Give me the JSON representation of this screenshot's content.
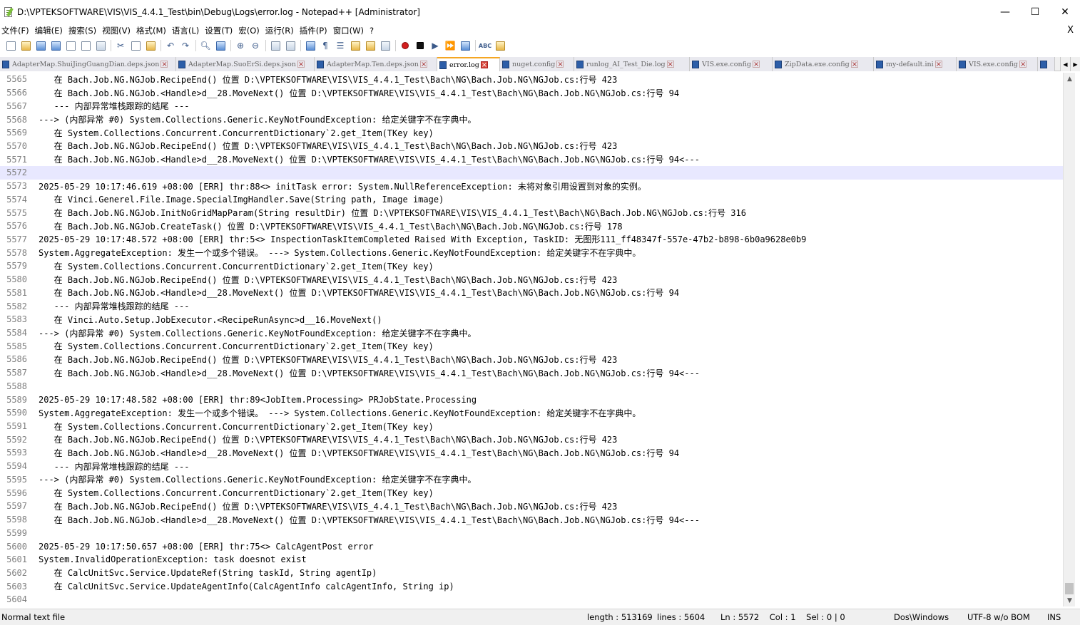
{
  "window": {
    "title": "D:\\VPTEKSOFTWARE\\VIS\\VIS_4.4.1_Test\\bin\\Debug\\Logs\\error.log - Notepad++ [Administrator]",
    "minimize": "—",
    "maximize": "☐",
    "close": "✕"
  },
  "menu": {
    "items": [
      "文件(F)",
      "编辑(E)",
      "搜索(S)",
      "视图(V)",
      "格式(M)",
      "语言(L)",
      "设置(T)",
      "宏(O)",
      "运行(R)",
      "插件(P)",
      "窗口(W)",
      "?"
    ],
    "close": "X"
  },
  "toolbar": {
    "icons": [
      "new-file-icon",
      "open-file-icon",
      "save-icon",
      "save-all-icon",
      "close-icon",
      "close-all-icon",
      "print-icon",
      "cut-icon",
      "copy-icon",
      "paste-icon",
      "undo-icon",
      "redo-icon",
      "find-icon",
      "replace-icon",
      "zoom-in-icon",
      "zoom-out-icon",
      "sync-vertical-icon",
      "sync-horizontal-icon",
      "word-wrap-icon",
      "show-all-chars-icon",
      "indent-guide-icon",
      "folder-as-workspace-icon",
      "function-list-icon",
      "document-map-icon",
      "record-macro-icon",
      "stop-record-icon",
      "play-macro-icon",
      "play-multiple-icon",
      "save-macro-icon",
      "spell-check-icon",
      "spell-options-icon"
    ]
  },
  "tabs": [
    {
      "label": "AdapterMap.ShuiJingGuangDian.deps.json",
      "active": false
    },
    {
      "label": "AdapterMap.SuoErSi.deps.json",
      "active": false
    },
    {
      "label": "AdapterMap.Ten.deps.json",
      "active": false
    },
    {
      "label": "error.log",
      "active": true
    },
    {
      "label": "nuget.config",
      "active": false
    },
    {
      "label": "runlog_AI_Test_Die.log",
      "active": false
    },
    {
      "label": "VIS.exe.config",
      "active": false
    },
    {
      "label": "ZipData.exe.config",
      "active": false
    },
    {
      "label": "my-default.ini",
      "active": false
    },
    {
      "label": "VIS.exe.config",
      "active": false
    }
  ],
  "editor": {
    "current_line": 5572,
    "lines": [
      {
        "n": "5565",
        "t": "   在 Bach.Job.NG.NGJob.RecipeEnd() 位置 D:\\VPTEKSOFTWARE\\VIS\\VIS_4.4.1_Test\\Bach\\NG\\Bach.Job.NG\\NGJob.cs:行号 423"
      },
      {
        "n": "5566",
        "t": "   在 Bach.Job.NG.NGJob.<Handle>d__28.MoveNext() 位置 D:\\VPTEKSOFTWARE\\VIS\\VIS_4.4.1_Test\\Bach\\NG\\Bach.Job.NG\\NGJob.cs:行号 94"
      },
      {
        "n": "5567",
        "t": "   --- 内部异常堆栈跟踪的结尾 ---"
      },
      {
        "n": "5568",
        "t": "---> (内部异常 #0) System.Collections.Generic.KeyNotFoundException: 给定关键字不在字典中。"
      },
      {
        "n": "5569",
        "t": "   在 System.Collections.Concurrent.ConcurrentDictionary`2.get_Item(TKey key)"
      },
      {
        "n": "5570",
        "t": "   在 Bach.Job.NG.NGJob.RecipeEnd() 位置 D:\\VPTEKSOFTWARE\\VIS\\VIS_4.4.1_Test\\Bach\\NG\\Bach.Job.NG\\NGJob.cs:行号 423"
      },
      {
        "n": "5571",
        "t": "   在 Bach.Job.NG.NGJob.<Handle>d__28.MoveNext() 位置 D:\\VPTEKSOFTWARE\\VIS\\VIS_4.4.1_Test\\Bach\\NG\\Bach.Job.NG\\NGJob.cs:行号 94<---"
      },
      {
        "n": "5572",
        "t": ""
      },
      {
        "n": "5573",
        "t": "2025-05-29 10:17:46.619 +08:00 [ERR] thr:88<> initTask error: System.NullReferenceException: 未将对象引用设置到对象的实例。"
      },
      {
        "n": "5574",
        "t": "   在 Vinci.Generel.File.Image.SpecialImgHandler.Save(String path, Image image)"
      },
      {
        "n": "5575",
        "t": "   在 Bach.Job.NG.NGJob.InitNoGridMapParam(String resultDir) 位置 D:\\VPTEKSOFTWARE\\VIS\\VIS_4.4.1_Test\\Bach\\NG\\Bach.Job.NG\\NGJob.cs:行号 316"
      },
      {
        "n": "5576",
        "t": "   在 Bach.Job.NG.NGJob.CreateTask() 位置 D:\\VPTEKSOFTWARE\\VIS\\VIS_4.4.1_Test\\Bach\\NG\\Bach.Job.NG\\NGJob.cs:行号 178"
      },
      {
        "n": "5577",
        "t": "2025-05-29 10:17:48.572 +08:00 [ERR] thr:5<> InspectionTaskItemCompleted Raised With Exception, TaskID: 无图形111_ff48347f-557e-47b2-b898-6b0a9628e0b9"
      },
      {
        "n": "5578",
        "t": "System.AggregateException: 发生一个或多个错误。 ---> System.Collections.Generic.KeyNotFoundException: 给定关键字不在字典中。"
      },
      {
        "n": "5579",
        "t": "   在 System.Collections.Concurrent.ConcurrentDictionary`2.get_Item(TKey key)"
      },
      {
        "n": "5580",
        "t": "   在 Bach.Job.NG.NGJob.RecipeEnd() 位置 D:\\VPTEKSOFTWARE\\VIS\\VIS_4.4.1_Test\\Bach\\NG\\Bach.Job.NG\\NGJob.cs:行号 423"
      },
      {
        "n": "5581",
        "t": "   在 Bach.Job.NG.NGJob.<Handle>d__28.MoveNext() 位置 D:\\VPTEKSOFTWARE\\VIS\\VIS_4.4.1_Test\\Bach\\NG\\Bach.Job.NG\\NGJob.cs:行号 94"
      },
      {
        "n": "5582",
        "t": "   --- 内部异常堆栈跟踪的结尾 ---"
      },
      {
        "n": "5583",
        "t": "   在 Vinci.Auto.Setup.JobExecutor.<RecipeRunAsync>d__16.MoveNext()"
      },
      {
        "n": "5584",
        "t": "---> (内部异常 #0) System.Collections.Generic.KeyNotFoundException: 给定关键字不在字典中。"
      },
      {
        "n": "5585",
        "t": "   在 System.Collections.Concurrent.ConcurrentDictionary`2.get_Item(TKey key)"
      },
      {
        "n": "5586",
        "t": "   在 Bach.Job.NG.NGJob.RecipeEnd() 位置 D:\\VPTEKSOFTWARE\\VIS\\VIS_4.4.1_Test\\Bach\\NG\\Bach.Job.NG\\NGJob.cs:行号 423"
      },
      {
        "n": "5587",
        "t": "   在 Bach.Job.NG.NGJob.<Handle>d__28.MoveNext() 位置 D:\\VPTEKSOFTWARE\\VIS\\VIS_4.4.1_Test\\Bach\\NG\\Bach.Job.NG\\NGJob.cs:行号 94<---"
      },
      {
        "n": "5588",
        "t": ""
      },
      {
        "n": "5589",
        "t": "2025-05-29 10:17:48.582 +08:00 [ERR] thr:89<JobItem.Processing> PRJobState.Processing"
      },
      {
        "n": "5590",
        "t": "System.AggregateException: 发生一个或多个错误。 ---> System.Collections.Generic.KeyNotFoundException: 给定关键字不在字典中。"
      },
      {
        "n": "5591",
        "t": "   在 System.Collections.Concurrent.ConcurrentDictionary`2.get_Item(TKey key)"
      },
      {
        "n": "5592",
        "t": "   在 Bach.Job.NG.NGJob.RecipeEnd() 位置 D:\\VPTEKSOFTWARE\\VIS\\VIS_4.4.1_Test\\Bach\\NG\\Bach.Job.NG\\NGJob.cs:行号 423"
      },
      {
        "n": "5593",
        "t": "   在 Bach.Job.NG.NGJob.<Handle>d__28.MoveNext() 位置 D:\\VPTEKSOFTWARE\\VIS\\VIS_4.4.1_Test\\Bach\\NG\\Bach.Job.NG\\NGJob.cs:行号 94"
      },
      {
        "n": "5594",
        "t": "   --- 内部异常堆栈跟踪的结尾 ---"
      },
      {
        "n": "5595",
        "t": "---> (内部异常 #0) System.Collections.Generic.KeyNotFoundException: 给定关键字不在字典中。"
      },
      {
        "n": "5596",
        "t": "   在 System.Collections.Concurrent.ConcurrentDictionary`2.get_Item(TKey key)"
      },
      {
        "n": "5597",
        "t": "   在 Bach.Job.NG.NGJob.RecipeEnd() 位置 D:\\VPTEKSOFTWARE\\VIS\\VIS_4.4.1_Test\\Bach\\NG\\Bach.Job.NG\\NGJob.cs:行号 423"
      },
      {
        "n": "5598",
        "t": "   在 Bach.Job.NG.NGJob.<Handle>d__28.MoveNext() 位置 D:\\VPTEKSOFTWARE\\VIS\\VIS_4.4.1_Test\\Bach\\NG\\Bach.Job.NG\\NGJob.cs:行号 94<---"
      },
      {
        "n": "5599",
        "t": ""
      },
      {
        "n": "5600",
        "t": "2025-05-29 10:17:50.657 +08:00 [ERR] thr:75<> CalcAgentPost error"
      },
      {
        "n": "5601",
        "t": "System.InvalidOperationException: task doesnot exist"
      },
      {
        "n": "5602",
        "t": "   在 CalcUnitSvc.Service.UpdateRef(String taskId, String agentIp)"
      },
      {
        "n": "5603",
        "t": "   在 CalcUnitSvc.Service.UpdateAgentInfo(CalcAgentInfo calcAgentInfo, String ip)"
      },
      {
        "n": "5604",
        "t": ""
      }
    ]
  },
  "status": {
    "file_type": "Normal text file",
    "length": "length : 513169",
    "lines": "lines : 5604",
    "position": "Ln : 5572    Col : 1    Sel : 0 | 0",
    "eol": "Dos\\Windows",
    "encoding": "UTF-8 w/o BOM",
    "mode": "INS"
  }
}
